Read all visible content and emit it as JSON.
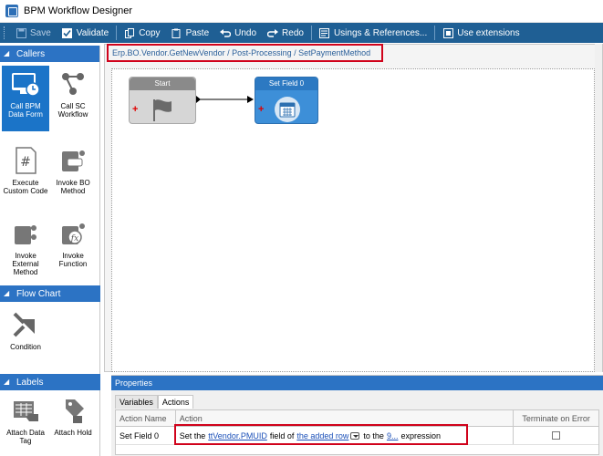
{
  "window": {
    "title": "BPM Workflow Designer"
  },
  "toolbar": {
    "save": "Save",
    "validate": "Validate",
    "copy": "Copy",
    "paste": "Paste",
    "undo": "Undo",
    "redo": "Redo",
    "usings": "Usings & References...",
    "extensions": "Use extensions"
  },
  "sidebar": {
    "callers": {
      "header": "Callers",
      "items": [
        {
          "label": "Call BPM Data Form",
          "icon": "monitor-clock-icon",
          "selected": true
        },
        {
          "label": "Call SC Workflow",
          "icon": "workflow-nodes-icon"
        },
        {
          "label": "Execute Custom Code",
          "icon": "hash-document-icon"
        },
        {
          "label": "Invoke BO Method",
          "icon": "bo-method-icon"
        },
        {
          "label": "Invoke External Method",
          "icon": "external-method-icon"
        },
        {
          "label": "Invoke Function",
          "icon": "function-icon"
        }
      ]
    },
    "flowchart": {
      "header": "Flow Chart",
      "items": [
        {
          "label": "Condition",
          "icon": "condition-arrows-icon"
        }
      ]
    },
    "labels": {
      "header": "Labels",
      "items": [
        {
          "label": "Attach Data Tag",
          "icon": "data-tag-icon"
        },
        {
          "label": "Attach Hold",
          "icon": "hold-tag-icon"
        }
      ]
    }
  },
  "breadcrumb": "Erp.BO.Vendor.GetNewVendor / Post-Processing / SetPaymentMethod",
  "canvas": {
    "nodes": [
      {
        "title": "Start",
        "icon": "flag-icon"
      },
      {
        "title": "Set Field 0",
        "icon": "calendar-icon"
      }
    ]
  },
  "properties": {
    "header": "Properties",
    "tabs": [
      "Variables",
      "Actions"
    ],
    "active_tab": "Actions",
    "columns": [
      "Action Name",
      "Action",
      "Terminate on Error"
    ],
    "rows": [
      {
        "name": "Set Field 0",
        "action": {
          "prefix": "Set the",
          "field_link": "ttVendor.PMUID",
          "mid1": "field of",
          "row_link": "the added row",
          "mid2": "to the",
          "expr_link": "9...",
          "suffix": "expression"
        },
        "terminate": false
      }
    ]
  },
  "colors": {
    "toolbar_bg": "#1f5f94",
    "section_header": "#2c73c4",
    "selected_tool": "#1b74c8",
    "highlight_border": "#d0021b",
    "start_node": "#c9c9c9",
    "setfield_node": "#3d8fd8"
  }
}
